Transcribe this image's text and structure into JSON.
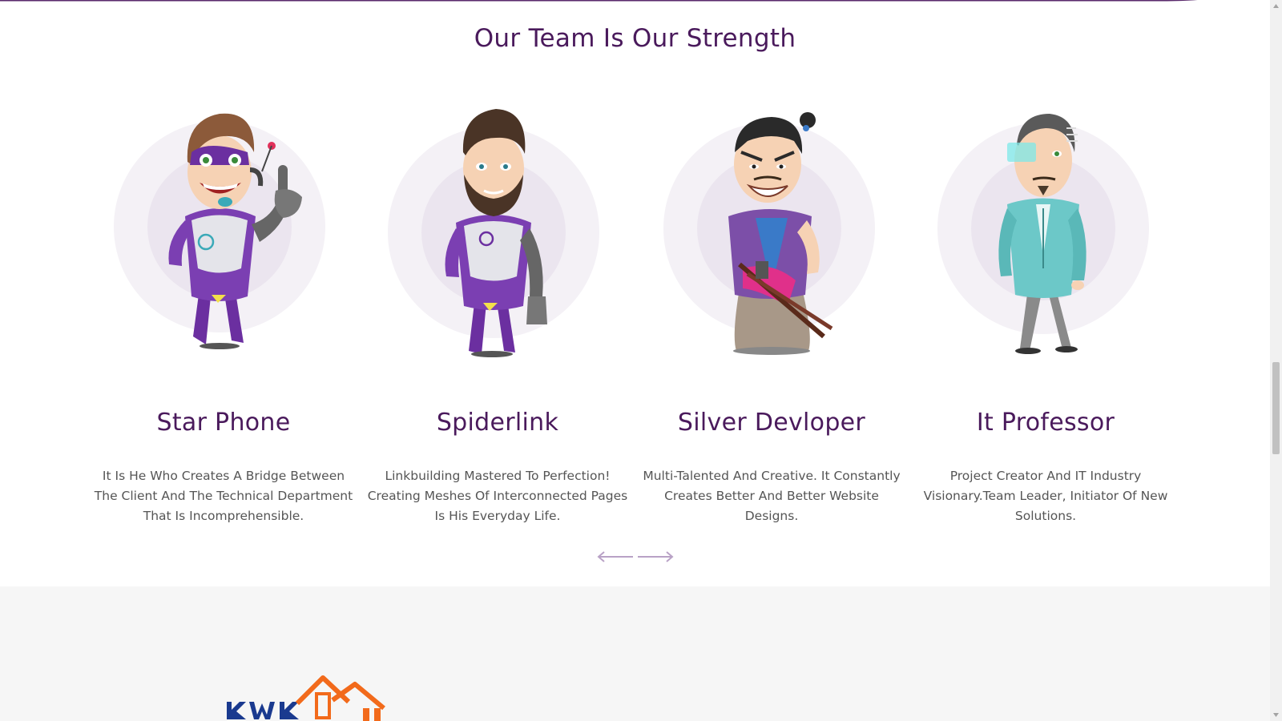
{
  "section": {
    "title": "Our Team Is Our Strength"
  },
  "team": [
    {
      "name": "Star Phone",
      "description": "It Is He Who Creates A Bridge Between The Client And The Technical Department That Is Incomprehensible.",
      "avatar_icon": "superhero-headset-icon"
    },
    {
      "name": "Spiderlink",
      "description": "Linkbuilding Mastered To Perfection! Creating Meshes Of Interconnected Pages Is His Everyday Life.",
      "avatar_icon": "bearded-hero-icon"
    },
    {
      "name": "Silver Devloper",
      "description": "Multi-Talented And Creative. It Constantly Creates Better And Better Website Designs.",
      "avatar_icon": "samurai-icon"
    },
    {
      "name": "It Professor",
      "description": "Project Creator And IT Industry Visionary.Team Leader, Initiator Of New Solutions.",
      "avatar_icon": "professor-hologram-glasses-icon"
    }
  ],
  "carousel": {
    "prev_icon": "arrow-left-icon",
    "next_icon": "arrow-right-icon"
  },
  "footer": {
    "logo_text": "KWK"
  },
  "colors": {
    "heading": "#4a1a5c",
    "text": "#555555",
    "accent_purple": "#6b2fa0",
    "logo_blue": "#1a3a8f",
    "logo_orange": "#f26a1b",
    "footer_bg": "#f6f6f6"
  }
}
